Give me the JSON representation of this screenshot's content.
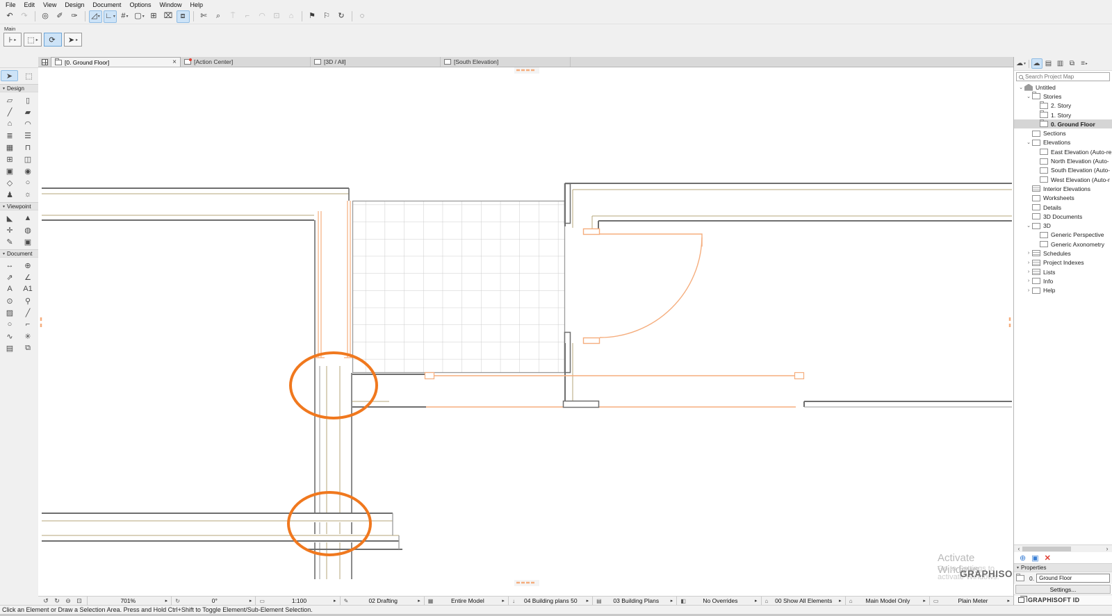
{
  "colors": {
    "wall-gray": "#6e6e6e",
    "wall-light": "#9a9a9a",
    "tan": "#b4a678",
    "door-orange": "#f5ad7d",
    "highlight-orange": "#f0781e",
    "grid-line": "#cccccc"
  },
  "icons": {
    "caret_down": "▾",
    "caret_right": "▸",
    "arrow_left": "‹",
    "arrow_right": "›"
  },
  "menu": {
    "items": [
      {
        "label": "File"
      },
      {
        "label": "Edit"
      },
      {
        "label": "View"
      },
      {
        "label": "Design"
      },
      {
        "label": "Document"
      },
      {
        "label": "Options"
      },
      {
        "label": "Window"
      },
      {
        "label": "Help"
      }
    ]
  },
  "toolbar": {
    "buttons": [
      {
        "name": "undo-icon",
        "g": "↶",
        "cls": "",
        "caret": "",
        "ia": "true"
      },
      {
        "name": "redo-icon",
        "g": "↷",
        "cls": "dis",
        "caret": "",
        "ia": "true"
      },
      {
        "name": "separator",
        "g": "",
        "cls": "sep",
        "caret": "",
        "ia": "false"
      },
      {
        "name": "element-select-icon",
        "g": "◎",
        "cls": "",
        "caret": "",
        "ia": "true"
      },
      {
        "name": "pick-up-parameters-icon",
        "g": "✐",
        "cls": "",
        "caret": "",
        "ia": "true"
      },
      {
        "name": "inject-parameters-icon",
        "g": "✑",
        "cls": "",
        "caret": "",
        "ia": "true"
      },
      {
        "name": "separator",
        "g": "",
        "cls": "sep",
        "caret": "",
        "ia": "false"
      },
      {
        "name": "guide-lines-icon",
        "g": "◿",
        "cls": "hl",
        "caret": "▾",
        "ia": "true"
      },
      {
        "name": "snap-guides-icon",
        "g": "∟",
        "cls": "hl",
        "caret": "▾",
        "ia": "true"
      },
      {
        "name": "snap-grid-icon",
        "g": "#",
        "cls": "",
        "caret": "▾",
        "ia": "true"
      },
      {
        "name": "gravity-icon",
        "g": "▢",
        "cls": "",
        "caret": "▾",
        "ia": "true"
      },
      {
        "name": "coordinates-icon",
        "g": "⊞",
        "cls": "",
        "caret": "",
        "ia": "true"
      },
      {
        "name": "suspend-groups-icon",
        "g": "⌧",
        "cls": "",
        "caret": "",
        "ia": "true"
      },
      {
        "name": "marquee-mode-icon",
        "g": "⧈",
        "cls": "hl",
        "caret": "",
        "ia": "true"
      },
      {
        "name": "separator",
        "g": "",
        "cls": "sep",
        "caret": "",
        "ia": "false"
      },
      {
        "name": "trim-icon",
        "g": "✄",
        "cls": "",
        "caret": "",
        "ia": "true"
      },
      {
        "name": "adjust-icon",
        "g": "⌕",
        "cls": "",
        "caret": "",
        "ia": "true"
      },
      {
        "name": "split-icon",
        "g": "⍑",
        "cls": "dis",
        "caret": "",
        "ia": "true"
      },
      {
        "name": "fillet-icon",
        "g": "⌐",
        "cls": "dis",
        "caret": "",
        "ia": "true"
      },
      {
        "name": "arc-edit-icon",
        "g": "◠",
        "cls": "dis",
        "caret": "",
        "ia": "true"
      },
      {
        "name": "intersect-icon",
        "g": "⊡",
        "cls": "dis",
        "caret": "",
        "ia": "true"
      },
      {
        "name": "resize-icon",
        "g": "⌂",
        "cls": "dis",
        "caret": "",
        "ia": "true"
      },
      {
        "name": "separator",
        "g": "",
        "cls": "sep",
        "caret": "",
        "ia": "false"
      },
      {
        "name": "flag-marker-icon",
        "g": "⚑",
        "cls": "",
        "caret": "",
        "ia": "true"
      },
      {
        "name": "flag-outline-icon",
        "g": "⚐",
        "cls": "",
        "caret": "",
        "ia": "true"
      },
      {
        "name": "rebuild-icon",
        "g": "↻",
        "cls": "",
        "caret": "",
        "ia": "true"
      },
      {
        "name": "separator",
        "g": "",
        "cls": "sep",
        "caret": "",
        "ia": "false"
      },
      {
        "name": "more-tools-icon",
        "g": "◌",
        "cls": "",
        "caret": "",
        "ia": "true"
      }
    ]
  },
  "main_row": {
    "label": "Main",
    "buttons": [
      {
        "name": "wall-preview-button",
        "g": "⊦",
        "cls": "",
        "caret": "▸",
        "ia": "true"
      },
      {
        "name": "marquee-preview-button",
        "g": "⬚",
        "cls": "",
        "caret": "▸",
        "ia": "true"
      },
      {
        "name": "rotate-button",
        "g": "⟳",
        "cls": "hl",
        "caret": "",
        "ia": "true"
      },
      {
        "name": "arrow-tool-button",
        "g": "➤",
        "cls": "",
        "caret": "▸",
        "ia": "true"
      }
    ]
  },
  "tabs": {
    "items": [
      {
        "name": "tab-ground-floor",
        "ico": "i-fold",
        "label": "[0. Ground Floor]",
        "cls": "active",
        "close": "×"
      },
      {
        "name": "tab-action-center",
        "ico": "i-dot",
        "label": "[Action Center]",
        "cls": "",
        "close": ""
      },
      {
        "name": "tab-3d-all",
        "ico": "i-cube",
        "label": "[3D / All]",
        "cls": "",
        "close": ""
      },
      {
        "name": "tab-south-elevation",
        "ico": "",
        "label": "[South Elevation]",
        "cls": "",
        "close": ""
      }
    ]
  },
  "toolbox": {
    "select": [
      {
        "name": "arrow-tool",
        "g": "➤",
        "cls": "hl"
      },
      {
        "name": "marquee-tool",
        "g": "⬚",
        "cls": ""
      }
    ],
    "design_title": "Design",
    "design": [
      {
        "name": "wall-tool",
        "g": "▱"
      },
      {
        "name": "column-tool",
        "g": "▯"
      },
      {
        "name": "beam-tool",
        "g": "╱"
      },
      {
        "name": "slab-tool",
        "g": "▰"
      },
      {
        "name": "roof-tool",
        "g": "⌂"
      },
      {
        "name": "shell-tool",
        "g": "◠"
      },
      {
        "name": "stair-tool",
        "g": "≣"
      },
      {
        "name": "railing-tool",
        "g": "☰"
      },
      {
        "name": "curtain-wall-tool",
        "g": "▦"
      },
      {
        "name": "door-tool",
        "g": "⊓"
      },
      {
        "name": "window-tool",
        "g": "⊞"
      },
      {
        "name": "skylight-tool",
        "g": "◫"
      },
      {
        "name": "opening-tool",
        "g": "▣"
      },
      {
        "name": "object-tool",
        "g": "◉"
      },
      {
        "name": "morph-tool",
        "g": "◇"
      },
      {
        "name": "zone-tool",
        "g": "○"
      },
      {
        "name": "furnishing-tool",
        "g": "♟"
      },
      {
        "name": "lamp-tool",
        "g": "☼"
      }
    ],
    "viewpoint_title": "Viewpoint",
    "viewpoint": [
      {
        "name": "section-tool",
        "g": "◣"
      },
      {
        "name": "elevation-tool",
        "g": "▲"
      },
      {
        "name": "interior-elevation-tool",
        "g": "✛"
      },
      {
        "name": "3d-document-tool",
        "g": "◍"
      },
      {
        "name": "detail-tool",
        "g": "✎"
      },
      {
        "name": "camera-tool",
        "g": "▣"
      }
    ],
    "document_title": "Document",
    "document": [
      {
        "name": "dimension-tool",
        "g": "↔"
      },
      {
        "name": "level-dimension-tool",
        "g": "⊕"
      },
      {
        "name": "radial-dimension-tool",
        "g": "⇗"
      },
      {
        "name": "angle-dimension-tool",
        "g": "∠"
      },
      {
        "name": "text-tool",
        "g": "A"
      },
      {
        "name": "label-tool",
        "g": "A1"
      },
      {
        "name": "hotspot-tool",
        "g": "⊙"
      },
      {
        "name": "zone-stamp-tool",
        "g": "⚲"
      },
      {
        "name": "fill-tool",
        "g": "▨"
      },
      {
        "name": "line-tool",
        "g": "╱"
      },
      {
        "name": "arc-circle-tool",
        "g": "○"
      },
      {
        "name": "polyline-tool",
        "g": "⌐"
      },
      {
        "name": "spline-tool",
        "g": "∿"
      },
      {
        "name": "marker-tool",
        "g": "✳"
      },
      {
        "name": "figure-tool",
        "g": "▤"
      },
      {
        "name": "drawing-tool",
        "g": "⧉"
      }
    ]
  },
  "canvas": {
    "watermark1": "Activate Windows",
    "watermark2": "Go to Settings to activate Windows.",
    "watermark3": "GRAPHISOFT."
  },
  "navigator": {
    "header_icons": [
      {
        "name": "navigator-cloud-icon",
        "g": "☁",
        "cls": "",
        "caret": "▾",
        "ia": "true"
      },
      {
        "name": "separator",
        "g": "",
        "cls": "sep",
        "caret": "",
        "ia": "false"
      },
      {
        "name": "project-map-icon",
        "g": "☁",
        "cls": "hl",
        "caret": "",
        "ia": "true"
      },
      {
        "name": "view-map-icon",
        "g": "▤",
        "cls": "",
        "caret": "",
        "ia": "true"
      },
      {
        "name": "layout-book-icon",
        "g": "▥",
        "cls": "",
        "caret": "",
        "ia": "true"
      },
      {
        "name": "publisher-icon",
        "g": "⧉",
        "cls": "",
        "caret": "",
        "ia": "true"
      },
      {
        "name": "navigator-menu-icon",
        "g": "≡",
        "cls": "",
        "caret": "▸",
        "ia": "true"
      }
    ],
    "search_placeholder": "Search Project Map",
    "tree": [
      {
        "name": "node-untitled",
        "caret": "⌄",
        "ico": "i-home",
        "label": "Untitled",
        "lvl": 5,
        "cls": ""
      },
      {
        "name": "node-stories",
        "caret": "⌄",
        "ico": "i-fold",
        "label": "Stories",
        "lvl": 16,
        "cls": ""
      },
      {
        "name": "node-story-2",
        "caret": "",
        "ico": "i-fold",
        "label": "2. Story",
        "lvl": 27,
        "cls": ""
      },
      {
        "name": "node-story-1",
        "caret": "",
        "ico": "i-fold",
        "label": "1. Story",
        "lvl": 27,
        "cls": ""
      },
      {
        "name": "node-story-0",
        "caret": "",
        "ico": "i-fold",
        "label": "0. Ground Floor",
        "lvl": 27,
        "cls": "sel"
      },
      {
        "name": "node-sections",
        "caret": "",
        "ico": "i-box",
        "label": "Sections",
        "lvl": 16,
        "cls": ""
      },
      {
        "name": "node-elevations",
        "caret": "⌄",
        "ico": "i-box",
        "label": "Elevations",
        "lvl": 16,
        "cls": ""
      },
      {
        "name": "node-east-elevation",
        "caret": "",
        "ico": "i-box",
        "label": "East Elevation (Auto-re",
        "lvl": 27,
        "cls": ""
      },
      {
        "name": "node-north-elevation",
        "caret": "",
        "ico": "i-box",
        "label": "North Elevation (Auto-",
        "lvl": 27,
        "cls": ""
      },
      {
        "name": "node-south-elevation",
        "caret": "",
        "ico": "i-box",
        "label": "South Elevation (Auto-",
        "lvl": 27,
        "cls": ""
      },
      {
        "name": "node-west-elevation",
        "caret": "",
        "ico": "i-box",
        "label": "West Elevation (Auto-r",
        "lvl": 27,
        "cls": ""
      },
      {
        "name": "node-interior-elevations",
        "caret": "",
        "ico": "i-grid",
        "label": "Interior Elevations",
        "lvl": 16,
        "cls": ""
      },
      {
        "name": "node-worksheets",
        "caret": "",
        "ico": "i-box",
        "label": "Worksheets",
        "lvl": 16,
        "cls": ""
      },
      {
        "name": "node-details",
        "caret": "",
        "ico": "i-box",
        "label": "Details",
        "lvl": 16,
        "cls": ""
      },
      {
        "name": "node-3d-documents",
        "caret": "",
        "ico": "i-cube",
        "label": "3D Documents",
        "lvl": 16,
        "cls": ""
      },
      {
        "name": "node-3d",
        "caret": "⌄",
        "ico": "i-cube",
        "label": "3D",
        "lvl": 16,
        "cls": ""
      },
      {
        "name": "node-generic-perspective",
        "caret": "",
        "ico": "i-cube",
        "label": "Generic Perspective",
        "lvl": 27,
        "cls": ""
      },
      {
        "name": "node-generic-axonometry",
        "caret": "",
        "ico": "i-cube",
        "label": "Generic Axonometry",
        "lvl": 27,
        "cls": ""
      },
      {
        "name": "node-schedules",
        "caret": "›",
        "ico": "i-grid",
        "label": "Schedules",
        "lvl": 16,
        "cls": ""
      },
      {
        "name": "node-project-indexes",
        "caret": "›",
        "ico": "i-grid",
        "label": "Project Indexes",
        "lvl": 16,
        "cls": ""
      },
      {
        "name": "node-lists",
        "caret": "›",
        "ico": "i-grid",
        "label": "Lists",
        "lvl": 16,
        "cls": ""
      },
      {
        "name": "node-info",
        "caret": "›",
        "ico": "i-box",
        "label": "Info",
        "lvl": 16,
        "cls": ""
      },
      {
        "name": "node-help",
        "caret": "›",
        "ico": "i-box",
        "label": "Help",
        "lvl": 16,
        "cls": ""
      }
    ],
    "action_icons": [
      {
        "name": "add-viewpoint-icon",
        "g": "⊕",
        "cls": "blue",
        "ia": "true"
      },
      {
        "name": "viewpoint-settings-icon",
        "g": "▣",
        "cls": "blue",
        "ia": "true"
      },
      {
        "name": "delete-viewpoint-icon",
        "g": "✕",
        "cls": "red",
        "ia": "true"
      }
    ],
    "properties_title": "Properties",
    "story_prefix": "0.",
    "story_value": "Ground Floor",
    "settings_label": "Settings...",
    "brand": "GRAPHISOFT ID"
  },
  "statusbar": {
    "zoom_tools": [
      {
        "name": "prev-zoom-icon",
        "g": "↺",
        "ia": "true"
      },
      {
        "name": "next-zoom-icon",
        "g": "↻",
        "ia": "true"
      },
      {
        "name": "zoom-out-icon",
        "g": "⊖",
        "ia": "true"
      },
      {
        "name": "fit-in-window-icon",
        "g": "⊡",
        "ia": "true"
      }
    ],
    "segments": [
      {
        "name": "zoom-level",
        "icon": "",
        "label": "701%",
        "arrow": "▸"
      },
      {
        "name": "orientation",
        "icon": "↻",
        "label": "0°",
        "arrow": "▸"
      },
      {
        "name": "scale",
        "icon": "▭",
        "label": "1:100",
        "arrow": "▸"
      },
      {
        "name": "pen-set",
        "icon": "✎",
        "label": "02 Drafting",
        "arrow": "▸"
      },
      {
        "name": "structure-display",
        "icon": "▦",
        "label": "Entire Model",
        "arrow": "▸"
      },
      {
        "name": "dimensions-standard",
        "icon": "↓",
        "label": "04 Building plans 50",
        "arrow": "▸"
      },
      {
        "name": "model-view-options",
        "icon": "▤",
        "label": "03 Building Plans",
        "arrow": "▸"
      },
      {
        "name": "graphic-override",
        "icon": "◧",
        "label": "No Overrides",
        "arrow": "▸"
      },
      {
        "name": "renovation-filter",
        "icon": "⌂",
        "label": "00 Show All Elements",
        "arrow": "▸"
      },
      {
        "name": "renovation-options",
        "icon": "⌂",
        "label": "Main Model Only",
        "arrow": "▸"
      },
      {
        "name": "working-units",
        "icon": "▭",
        "label": "Plain Meter",
        "arrow": "▸"
      }
    ]
  },
  "hintbar": {
    "text": "Click an Element or Draw a Selection Area. Press and Hold Ctrl+Shift to Toggle Element/Sub-Element Selection."
  }
}
